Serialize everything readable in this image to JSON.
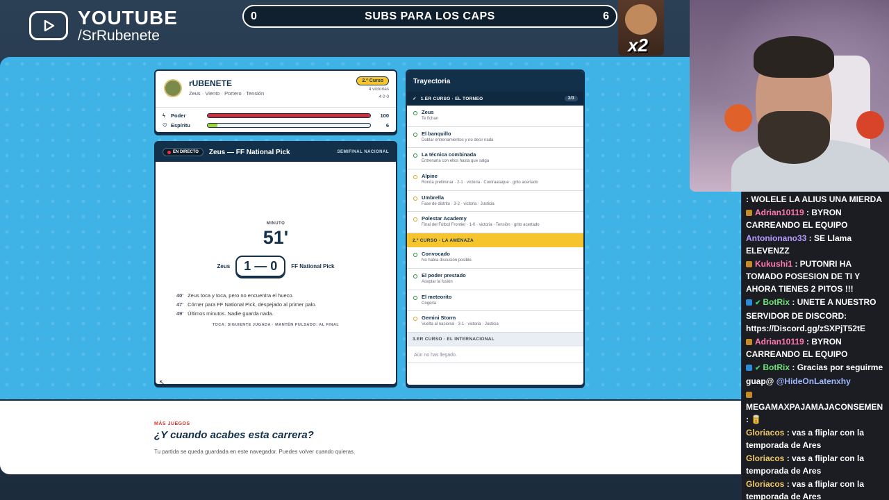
{
  "overlay": {
    "platform": "YOUTUBE",
    "handle": "/SrRubenete",
    "subs_left": "0",
    "subs_label": "SUBS PARA LOS CAPS",
    "subs_right": "6",
    "multiplier": "x2"
  },
  "player": {
    "name": "rUBENETE",
    "meta": "Zeus · Viento · Portero · Tensión",
    "course": "2.º Curso",
    "wins": "4 victorias",
    "mini_stats": "4   0   0",
    "bars": [
      {
        "label": "Poder",
        "value": "100",
        "fill": 1.0,
        "color": "#c8303c"
      },
      {
        "label": "Espíritu",
        "value": "6",
        "fill": 0.06,
        "color": "#9ed23a"
      }
    ]
  },
  "match": {
    "live_label": "EN DIRECTO",
    "title": "Zeus — FF National Pick",
    "phase": "SEMIFINAL NACIONAL",
    "minute_label": "MINUTO",
    "minute": "51'",
    "home": "Zeus",
    "score": "1 — 0",
    "away": "FF National Pick",
    "events": [
      {
        "t": "40'",
        "text": "Zeus toca y toca, pero no encuentra el hueco."
      },
      {
        "t": "47'",
        "text": "Córner para FF National Pick, despejado al primer palo."
      },
      {
        "t": "49'",
        "text": "Últimos minutos. Nadie guarda nada."
      }
    ],
    "hint": "TOCA: SIGUIENTE JUGADA · MANTÉN PULSADO: AL FINAL"
  },
  "trayectoria": {
    "title": "Trayectoria",
    "sections": [
      {
        "label": "1.ER CURSO · EL TORNEO",
        "count": "3/3",
        "items": [
          {
            "title": "Zeus",
            "sub": "Te fichan"
          },
          {
            "title": "El banquillo",
            "sub": "Doblar entrenamientos y no decir nada"
          },
          {
            "title": "La técnica combinada",
            "sub": "Entrenarla con ellos hasta que salga"
          },
          {
            "title": "Alpine",
            "sub": "Ronda preliminar · 2-1 · victoria · Contraataque · grito acertado"
          },
          {
            "title": "Umbrella",
            "sub": "Fase de distrito · 3-2 · victoria · Justicia"
          },
          {
            "title": "Polestar Academy",
            "sub": "Final del Fútbol Frontier · 1-0 · victoria · Tensión · grito acertado"
          }
        ]
      },
      {
        "label": "2.º CURSO · LA AMENAZA",
        "items": [
          {
            "title": "Convocado",
            "sub": "No había discusión posible."
          },
          {
            "title": "El poder prestado",
            "sub": "Aceptar la fusión"
          },
          {
            "title": "El meteorito",
            "sub": "Cogerla"
          },
          {
            "title": "Gemini Storm",
            "sub": "Vuelta al nacional · 3-1 · victoria · Justicia"
          }
        ]
      },
      {
        "label": "3.ER CURSO · EL INTERNACIONAL",
        "empty": "Aún no has llegado."
      }
    ]
  },
  "more": {
    "kicker": "MÁS JUEGOS",
    "title": "¿Y cuando acabes esta carrera?",
    "text": "Tu partida se queda guardada en este navegador. Puedes volver cuando quieras."
  },
  "chat": [
    {
      "user": "",
      "text": ": WOLELE LA ALIUS UNA MIERDA",
      "badge": "none"
    },
    {
      "user": "Adrian10119",
      "text": " : BYRON CARREANDO EL EQUIPO",
      "badge": "sub",
      "cls": "u1"
    },
    {
      "user": "Antonionano33",
      "text": " : SE Llama ELEVENZZ",
      "badge": "none",
      "cls": "u2"
    },
    {
      "user": "Kukushi1",
      "text": " : PUTONRI HA TOMADO POSESION DE TI Y AHORA TIENES 2 PITOS !!!",
      "badge": "sub",
      "cls": "u3"
    },
    {
      "user": "BotRix",
      "text": " : UNETE A NUESTRO SERVIDOR DE DISCORD: https://Discord.gg/zSXPjT52tE",
      "badge": "bot",
      "cls": "u4"
    },
    {
      "user": "Adrian10119",
      "text": " : BYRON CARREANDO EL EQUIPO",
      "badge": "sub",
      "cls": "u1"
    },
    {
      "user": "BotRix",
      "text": " : Gracias por seguirme guap@ ",
      "mention": "@HideOnLatenxhy",
      "badge": "bot",
      "cls": "u4"
    },
    {
      "user": "MEGAMAXPAJAMAJACONSEMEN",
      "text": " : 🥫",
      "badge": "sub",
      "cls": "u5"
    },
    {
      "user": "Gloriacos",
      "text": " : vas a fliplar con la temporada de Ares",
      "badge": "none",
      "cls": "u6"
    },
    {
      "user": "Gloriacos",
      "text": " : vas a fliplar con la temporada de Ares",
      "badge": "none",
      "cls": "u6"
    },
    {
      "user": "Gloriacos",
      "text": " : vas a fliplar con la temporada de Ares",
      "badge": "none",
      "cls": "u6"
    }
  ]
}
